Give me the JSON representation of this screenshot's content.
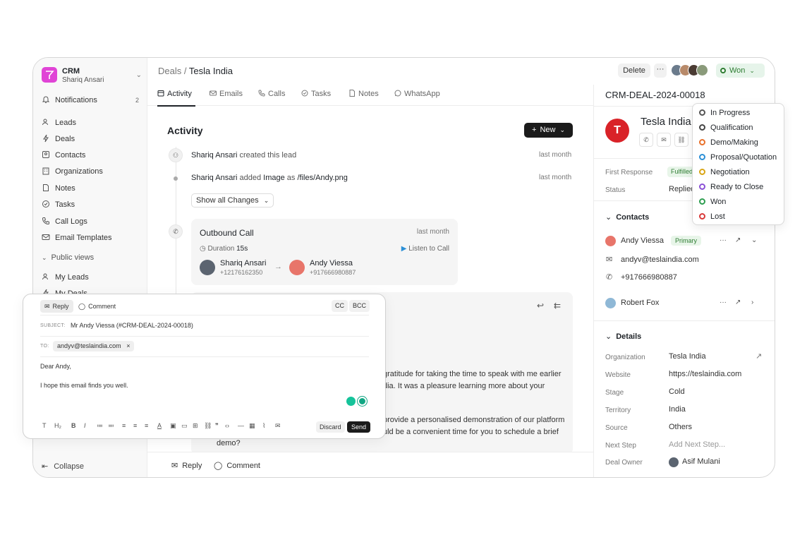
{
  "sidebar": {
    "app_name": "CRM",
    "user_name": "Shariq Ansari",
    "notifications": {
      "label": "Notifications",
      "count": "2"
    },
    "items": [
      {
        "label": "Leads",
        "icon": "users-icon"
      },
      {
        "label": "Deals",
        "icon": "lightning-icon"
      },
      {
        "label": "Contacts",
        "icon": "contact-icon"
      },
      {
        "label": "Organizations",
        "icon": "building-icon"
      },
      {
        "label": "Notes",
        "icon": "note-icon"
      },
      {
        "label": "Tasks",
        "icon": "check-circle-icon"
      },
      {
        "label": "Call Logs",
        "icon": "phone-icon"
      },
      {
        "label": "Email Templates",
        "icon": "mail-icon"
      }
    ],
    "public_views_label": "Public views",
    "public_views": [
      {
        "label": "My Leads",
        "icon": "users-icon"
      },
      {
        "label": "My Deals",
        "icon": "lightning-icon"
      }
    ],
    "collapse_label": "Collapse"
  },
  "header": {
    "breadcrumb_root": "Deals",
    "breadcrumb_sep": "/",
    "breadcrumb_current": "Tesla India",
    "delete_label": "Delete",
    "more_label": "···",
    "status_label": "Won"
  },
  "tabs": [
    {
      "label": "Activity",
      "icon": "activity-icon"
    },
    {
      "label": "Emails",
      "icon": "mail-icon"
    },
    {
      "label": "Calls",
      "icon": "phone-icon"
    },
    {
      "label": "Tasks",
      "icon": "check-circle-icon"
    },
    {
      "label": "Notes",
      "icon": "note-icon"
    },
    {
      "label": "WhatsApp",
      "icon": "whatsapp-icon"
    }
  ],
  "activity": {
    "title": "Activity",
    "new_label": "New",
    "entries": [
      {
        "actor": "Shariq Ansari",
        "action": "created this lead",
        "time": "last month"
      },
      {
        "actor": "Shariq Ansari",
        "action": "added",
        "field": "Image",
        "as_word": "as",
        "value": "/files/Andy.png",
        "time": "last month"
      }
    ],
    "show_all_label": "Show all Changes",
    "call": {
      "title": "Outbound Call",
      "time": "last month",
      "duration_label": "Duration",
      "duration": "15s",
      "listen_label": "Listen to Call",
      "caller": {
        "name": "Shariq Ansari",
        "phone": "+12176162350"
      },
      "receiver": {
        "name": "Andy Viessa",
        "phone": "+917666980887"
      }
    },
    "email_snippets": [
      "gratitude for taking the time to speak with me earlier",
      "dia. It was a pleasure learning more about your",
      "provide a personalised demonstration of our platform",
      "uld be a convenient time for you to schedule a brief",
      "demo?"
    ]
  },
  "footer": {
    "reply_label": "Reply",
    "comment_label": "Comment"
  },
  "composer": {
    "reply_tab": "Reply",
    "comment_tab": "Comment",
    "cc_label": "CC",
    "bcc_label": "BCC",
    "subject_label": "SUBJECT:",
    "subject_value": "Mr Andy Viessa (#CRM-DEAL-2024-00018)",
    "to_label": "TO:",
    "to_value": "andyv@teslaindia.com",
    "body_line1": "Dear Andy,",
    "body_line2": "I hope this email finds you well.",
    "discard_label": "Discard",
    "send_label": "Send",
    "toolbar_icons": [
      "T",
      "H₂",
      "B",
      "I",
      "≔",
      "≕",
      "≡",
      "≡",
      "≡",
      "A",
      "▣",
      "▭",
      "⊞",
      "⛓",
      "❞",
      "‹›",
      "—",
      "▦",
      "⌇",
      "✉"
    ]
  },
  "right_panel": {
    "deal_id": "CRM-DEAL-2024-00018",
    "org_name": "Tesla India",
    "logo_letter": "T",
    "first_response_label": "First Response",
    "first_response_value": "Fulfilled",
    "status_label": "Status",
    "status_value": "Replied",
    "contacts_title": "Contacts",
    "contacts": [
      {
        "name": "Andy Viessa",
        "badge": "Primary",
        "email": "andyv@teslaindia.com",
        "phone": "+917666980887"
      },
      {
        "name": "Robert Fox"
      }
    ],
    "details_title": "Details",
    "details": [
      {
        "label": "Organization",
        "value": "Tesla India"
      },
      {
        "label": "Website",
        "value": "https://teslaindia.com"
      },
      {
        "label": "Stage",
        "value": "Cold"
      },
      {
        "label": "Territory",
        "value": "India"
      },
      {
        "label": "Source",
        "value": "Others"
      },
      {
        "label": "Next Step",
        "value": "Add Next Step..."
      },
      {
        "label": "Deal Owner",
        "value": "Asif Mulani"
      }
    ]
  },
  "status_dropdown": {
    "options": [
      {
        "label": "In Progress",
        "color": "#555555"
      },
      {
        "label": "Qualification",
        "color": "#444444"
      },
      {
        "label": "Demo/Making",
        "color": "#e8702a"
      },
      {
        "label": "Proposal/Quotation",
        "color": "#2b8fd6"
      },
      {
        "label": "Negotiation",
        "color": "#d9a514"
      },
      {
        "label": "Ready to Close",
        "color": "#8a4fd6"
      },
      {
        "label": "Won",
        "color": "#2e9e50"
      },
      {
        "label": "Lost",
        "color": "#d93838"
      }
    ]
  },
  "colors": {
    "accent": "#1b1b1b",
    "brand": "#e044d6",
    "won": "#2e7d32",
    "tesla_red": "#d92228"
  }
}
